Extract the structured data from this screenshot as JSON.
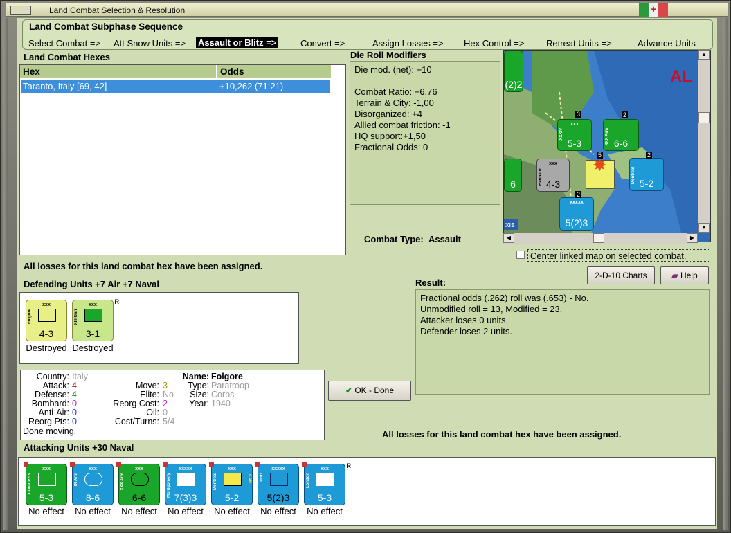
{
  "window": {
    "title": "Land Combat Selection & Resolution"
  },
  "subphase": {
    "title": "Land Combat Subphase Sequence",
    "steps": [
      "Select Combat =>",
      "Att Snow Units =>",
      "Assault or Blitz =>",
      "Convert =>",
      "Assign Losses =>",
      "Hex Control =>",
      "Retreat Units =>",
      "Advance Units"
    ],
    "active_index": 2
  },
  "hexes": {
    "title": "Land Combat Hexes",
    "columns": [
      "Hex",
      "Odds"
    ],
    "rows": [
      {
        "hex": "Taranto, Italy [69, 42]",
        "odds": "+10,262 (71:21)"
      }
    ]
  },
  "die_roll": {
    "title": "Die Roll Modifiers",
    "lines": [
      "Die mod. (net): +10",
      "",
      "Combat Ratio: +6,76",
      "Terrain & City: -1,00",
      "Disorganized: +4",
      "Allied combat friction: -1",
      "HQ support:+1,50",
      "Fractional Odds: 0"
    ]
  },
  "map": {
    "label_al": "AL",
    "label_xis": "xis",
    "units": [
      {
        "side": "XXXIV",
        "top": "xxx",
        "val": "5-3",
        "color": "#1aa62a"
      },
      {
        "side": "XXX Arm",
        "top": "xxx",
        "val": "6-6",
        "color": "#1aa62a"
      },
      {
        "side": "Hermann",
        "top": "xxx",
        "val": "4-3",
        "color": "#a8a8a8"
      },
      {
        "side": "Montreal",
        "top": "xxx",
        "val": "5-2",
        "color": "#1e9ad6"
      },
      {
        "side": "Gort",
        "top": "xxxxx",
        "val": "5(2)3",
        "color": "#1e9ad6"
      },
      {
        "side": "",
        "top": "xxx",
        "val": "(2)2",
        "color": "#1aa62a"
      },
      {
        "side": "",
        "top": "",
        "val": "6",
        "color": "#1aa62a"
      }
    ],
    "stack_counts": [
      "3",
      "2",
      "5",
      "2",
      "2"
    ]
  },
  "combat_type": {
    "label": "Combat Type:",
    "value": "Assault"
  },
  "center_map": {
    "label": "Center linked map on selected combat."
  },
  "buttons": {
    "charts": "2-D-10 Charts",
    "help": "Help",
    "ok": "OK - Done"
  },
  "losses_msg_top": "All losses for this land combat hex have been assigned.",
  "losses_msg_bottom": "All losses for this land combat hex have been assigned.",
  "defenders": {
    "title": "Defending Units +7 Air +7 Naval",
    "units": [
      {
        "name": "Folgore",
        "top": "xxx",
        "val": "4-3",
        "status": "Destroyed",
        "reserve": ""
      },
      {
        "name": "XIII Garr",
        "top": "xxx",
        "val": "3-1",
        "status": "Destroyed",
        "reserve": "R"
      }
    ]
  },
  "result": {
    "title": "Result:",
    "lines": [
      "Fractional odds (.262) roll was (.653)  - No.",
      "Unmodified roll = 13, Modified = 23.",
      "Attacker loses 0 units.",
      "Defender loses 2 units."
    ]
  },
  "unit_info": {
    "country_label": "Country:",
    "country": "Italy",
    "attack_label": "Attack:",
    "attack": "4",
    "defense_label": "Defense:",
    "defense": "4",
    "bombard_label": "Bombard:",
    "bombard": "0",
    "antiair_label": "Anti-Air:",
    "antiair": "0",
    "reorg_pts_label": "Reorg Pts:",
    "reorg_pts": "0",
    "done_moving": "Done moving.",
    "move_label": "Move:",
    "move": "3",
    "elite_label": "Elite:",
    "elite": "No",
    "reorg_cost_label": "Reorg Cost:",
    "reorg_cost": "2",
    "oil_label": "Oil:",
    "oil": "0",
    "cost_turns_label": "Cost/Turns:",
    "cost_turns": "5/4",
    "name_label": "Name:",
    "name": "Folgore",
    "type_label": "Type:",
    "type": "Paratroop",
    "size_label": "Size:",
    "size": "Corps",
    "year_label": "Year:",
    "year": "1940"
  },
  "attackers": {
    "title": "Attacking Units +30 Naval",
    "units": [
      {
        "name": "XXXIV Pzrs",
        "top": "xxx",
        "val": "5-3",
        "color": "green",
        "status": "No effect",
        "extra": ""
      },
      {
        "name": "IX Arm",
        "top": "xxx",
        "val": "8-6",
        "color": "blue",
        "status": "No effect",
        "extra": ""
      },
      {
        "name": "XXX Arm",
        "top": "xxx",
        "val": "6-6",
        "color": "green",
        "status": "No effect",
        "extra": ""
      },
      {
        "name": "Montgomery",
        "top": "xxxxx",
        "val": "7(3)3",
        "color": "blue",
        "status": "No effect",
        "extra": ""
      },
      {
        "name": "Montreal",
        "top": "xxx",
        "val": "5-2",
        "color": "blue",
        "status": "No effect",
        "extra": "CAN"
      },
      {
        "name": "Gort",
        "top": "xxxxx",
        "val": "5(2)3",
        "color": "blue",
        "status": "No effect",
        "extra": ""
      },
      {
        "name": "London",
        "top": "xxx",
        "val": "5-3",
        "color": "blue",
        "status": "No effect",
        "extra": "R"
      }
    ]
  },
  "colors": {
    "panel_bg": "#d0dcb3",
    "green_box": "#c8d8a8",
    "highlight": "#3d8edb",
    "unit_green": "#1aa62a",
    "unit_blue": "#1e9ad6",
    "unit_yellow": "#e8ef86"
  }
}
